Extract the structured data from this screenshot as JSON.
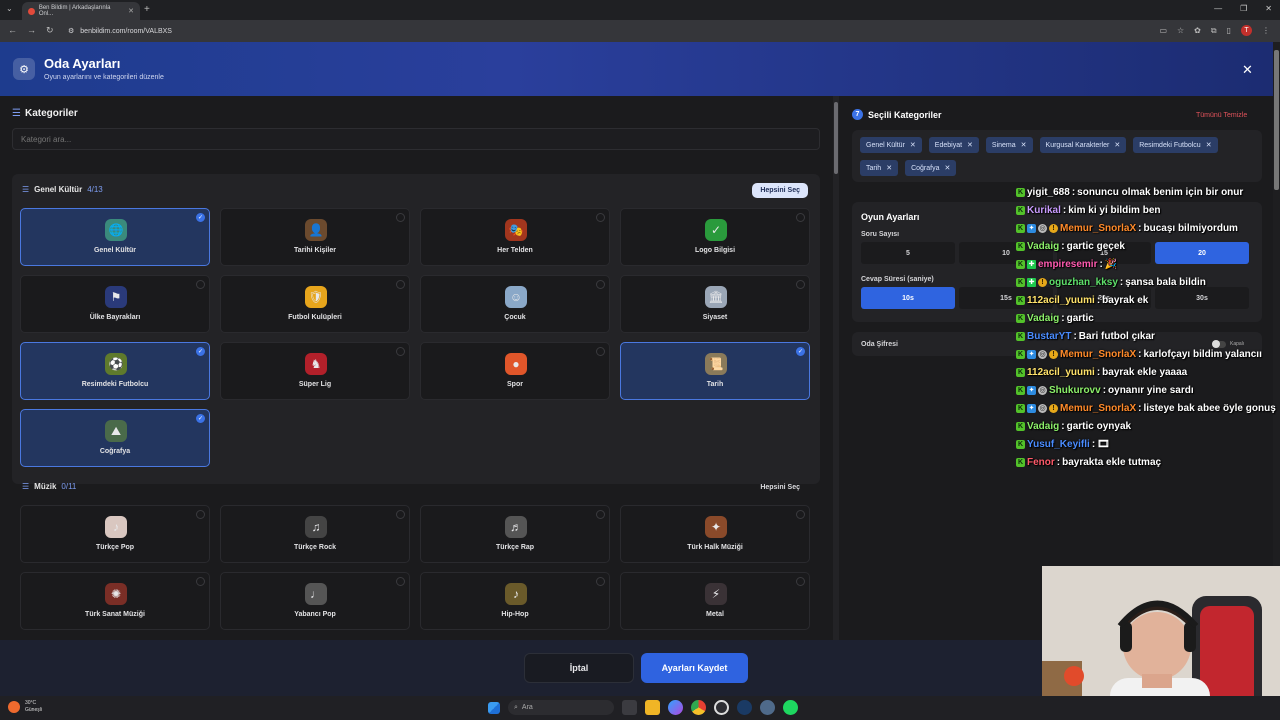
{
  "browser": {
    "tab_title": "Ben Bildim | Arkadaşlarınla Onl...",
    "url": "benbildim.com/room/VALBXS",
    "profile_initial": "T"
  },
  "header": {
    "title": "Oda Ayarları",
    "subtitle": "Oyun ayarlarını ve kategorileri düzenle"
  },
  "categories": {
    "title": "Kategoriler",
    "search_placeholder": "Kategori ara...",
    "groups": [
      {
        "name": "Genel Kültür",
        "count": "4/13",
        "select_all": "Hepsini Seç",
        "items": [
          {
            "label": "Genel Kültür",
            "selected": true,
            "icon": "globe-icon"
          },
          {
            "label": "Tarihi Kişiler",
            "selected": false,
            "icon": "portrait-icon"
          },
          {
            "label": "Her Telden",
            "selected": false,
            "icon": "mask-icon"
          },
          {
            "label": "Logo Bilgisi",
            "selected": false,
            "icon": "logo-icon"
          },
          {
            "label": "Ülke Bayrakları",
            "selected": false,
            "icon": "flag-icon"
          },
          {
            "label": "Futbol Kulüpleri",
            "selected": false,
            "icon": "club-badge-icon"
          },
          {
            "label": "Çocuk",
            "selected": false,
            "icon": "child-icon"
          },
          {
            "label": "Siyaset",
            "selected": false,
            "icon": "building-icon"
          },
          {
            "label": "Resimdeki Futbolcu",
            "selected": true,
            "icon": "footballer-icon"
          },
          {
            "label": "Süper Lig",
            "selected": false,
            "icon": "league-icon"
          },
          {
            "label": "Spor",
            "selected": false,
            "icon": "ball-icon"
          },
          {
            "label": "Tarih",
            "selected": true,
            "icon": "scroll-icon"
          },
          {
            "label": "Coğrafya",
            "selected": true,
            "icon": "mountain-icon"
          }
        ]
      },
      {
        "name": "Müzik",
        "count": "0/11",
        "select_all": "Hepsini Seç",
        "items": [
          {
            "label": "Türkçe Pop",
            "selected": false,
            "icon": "microphone-icon"
          },
          {
            "label": "Türkçe Rock",
            "selected": false,
            "icon": "guitar-icon"
          },
          {
            "label": "Türkçe Rap",
            "selected": false,
            "icon": "rapper-icon"
          },
          {
            "label": "Türk Halk Müziği",
            "selected": false,
            "icon": "saz-icon"
          },
          {
            "label": "Türk Sanat Müziği",
            "selected": false,
            "icon": "ud-icon"
          },
          {
            "label": "Yabancı Pop",
            "selected": false,
            "icon": "mic-stand-icon"
          },
          {
            "label": "Hip-Hop",
            "selected": false,
            "icon": "hiphop-icon"
          },
          {
            "label": "Metal",
            "selected": false,
            "icon": "metal-icon"
          }
        ]
      }
    ]
  },
  "selected": {
    "title": "Seçili Kategoriler",
    "count": "7",
    "clear_all": "Tümünü Temizle",
    "chips": [
      "Genel Kültür",
      "Edebiyat",
      "Sinema",
      "Kurgusal Karakterler",
      "Resimdeki Futbolcu",
      "Tarih",
      "Coğrafya"
    ]
  },
  "game_settings": {
    "title": "Oyun Ayarları",
    "question_count_label": "Soru Sayısı",
    "question_options": [
      "5",
      "10",
      "15",
      "20"
    ],
    "question_selected": "20",
    "answer_time_label": "Cevap Süresi (saniye)",
    "answer_options": [
      "10s",
      "15s",
      "20s",
      "30s"
    ],
    "answer_selected": "10s",
    "password_label": "Oda Şifresi",
    "password_state": "Kapalı"
  },
  "chat": [
    {
      "user": "yigit_688",
      "color": "#ffffff",
      "badges": [
        "k"
      ],
      "text": "sonuncu olmak benim için bir onur"
    },
    {
      "user": "Kurikal",
      "color": "#c99cff",
      "badges": [
        "k"
      ],
      "text": "kim ki yi bildim ben"
    },
    {
      "user": "Memur_SnorlaX",
      "color": "#ff8a2a",
      "badges": [
        "k",
        "p",
        "s",
        "g"
      ],
      "text": "bucaşı bilmiyordum"
    },
    {
      "user": "Vadaig",
      "color": "#8cf06a",
      "badges": [
        "k"
      ],
      "text": "gartic geçek"
    },
    {
      "user": "empiresemir",
      "color": "#ff5ab0",
      "badges": [
        "k",
        "v"
      ],
      "text": "🎉"
    },
    {
      "user": "oguzhan_kksy",
      "color": "#5ee06a",
      "badges": [
        "k",
        "v",
        "g"
      ],
      "text": "şansa bala bildin"
    },
    {
      "user": "112acil_yuumi",
      "color": "#ffe26a",
      "badges": [
        "k"
      ],
      "text": "bayrak ek"
    },
    {
      "user": "Vadaig",
      "color": "#8cf06a",
      "badges": [
        "k"
      ],
      "text": "gartic"
    },
    {
      "user": "BustarYT",
      "color": "#4a8cff",
      "badges": [
        "k"
      ],
      "text": "Bari futbol çıkar"
    },
    {
      "user": "Memur_SnorlaX",
      "color": "#ff8a2a",
      "badges": [
        "k",
        "p",
        "s",
        "g"
      ],
      "text": "karlofçayı bildim yalancıı"
    },
    {
      "user": "112acil_yuumi",
      "color": "#ffe26a",
      "badges": [
        "k"
      ],
      "text": "bayrak ekle yaaaa"
    },
    {
      "user": "Shukurovv",
      "color": "#8cf06a",
      "badges": [
        "k",
        "p",
        "s"
      ],
      "text": "oynanır yine sardı"
    },
    {
      "user": "Memur_SnorlaX",
      "color": "#ff8a2a",
      "badges": [
        "k",
        "p",
        "s",
        "g"
      ],
      "text": "listeye bak abee öyle gonuş"
    },
    {
      "user": "Vadaig",
      "color": "#8cf06a",
      "badges": [
        "k"
      ],
      "text": "gartic oynyak"
    },
    {
      "user": "Yusuf_Keyifli",
      "color": "#4a8cff",
      "badges": [
        "k"
      ],
      "text": "🎞"
    },
    {
      "user": "Fenor",
      "color": "#ff5a6a",
      "badges": [
        "k"
      ],
      "text": "bayrakta ekle tutmaç"
    }
  ],
  "footer": {
    "cancel": "İptal",
    "save": "Ayarları Kaydet"
  },
  "taskbar": {
    "temp": "30°C",
    "weather": "Güneşli",
    "search_placeholder": "Ara"
  }
}
